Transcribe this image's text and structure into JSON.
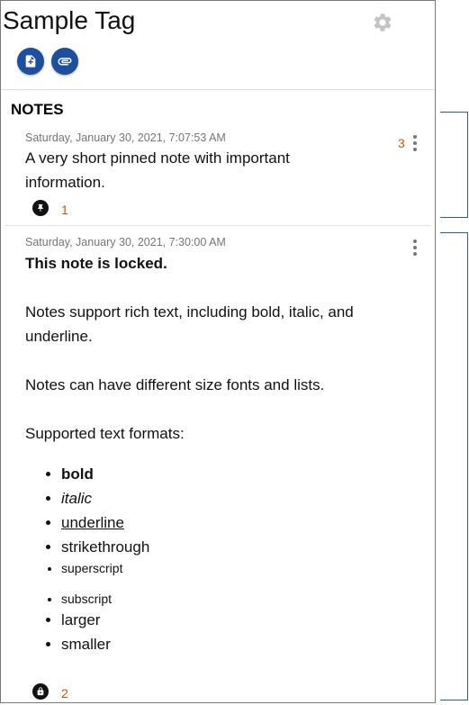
{
  "header": {
    "title": "Sample Tag",
    "settings_icon": "gear-icon",
    "add_note_icon": "file-plus-icon",
    "attach_icon": "paperclip-icon"
  },
  "notes_section": {
    "heading": "NOTES"
  },
  "notes": [
    {
      "timestamp": "Saturday, January 30, 2021, 7:07:53 AM",
      "text": "A very short pinned note with important information.",
      "menu_count": "3",
      "status_icon": "pin-icon",
      "status_count": "1"
    },
    {
      "timestamp": "Saturday, January 30, 2021, 7:30:00 AM",
      "locked_line": "This note is locked.",
      "paragraph1": "Notes support rich text, including bold, italic, and underline.",
      "paragraph2": "Notes can have different size fonts and lists.",
      "paragraph3": "Supported text formats:",
      "formats": [
        "bold",
        "italic",
        "underline",
        "strikethrough",
        "superscript",
        "subscript",
        "larger",
        "smaller"
      ],
      "status_icon": "lock-icon",
      "status_count": "2"
    }
  ],
  "colors": {
    "accent_blue": "#1c4fa0",
    "count_orange": "#c0570e",
    "bracket_blue": "#2c5f8a"
  }
}
